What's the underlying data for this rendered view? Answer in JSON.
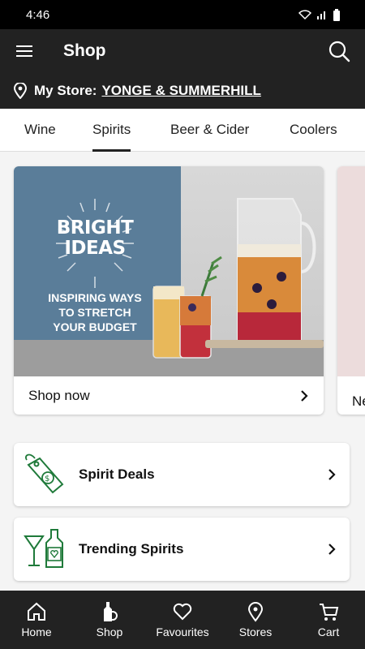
{
  "status": {
    "time": "4:46"
  },
  "header": {
    "title": "Shop"
  },
  "store": {
    "prefix": "My Store:",
    "name": "YONGE & SUMMERHILL"
  },
  "tabs": [
    {
      "label": "Wine"
    },
    {
      "label": "Spirits",
      "active": true
    },
    {
      "label": "Beer & Cider"
    },
    {
      "label": "Coolers"
    }
  ],
  "promo": {
    "heading_line1": "BRIGHT",
    "heading_line2": "IDEAS",
    "sub_line1": "INSPIRING WAYS",
    "sub_line2": "TO STRETCH",
    "sub_line3": "YOUR BUDGET",
    "cta": "Shop now"
  },
  "peek": {
    "label": "Ne"
  },
  "list": [
    {
      "label": "Spirit Deals",
      "icon": "price-tag-icon"
    },
    {
      "label": "Trending Spirits",
      "icon": "cocktail-bottle-icon"
    }
  ],
  "nav": [
    {
      "label": "Home",
      "icon": "home-icon"
    },
    {
      "label": "Shop",
      "icon": "bottle-icon"
    },
    {
      "label": "Favourites",
      "icon": "heart-icon"
    },
    {
      "label": "Stores",
      "icon": "location-pin-icon"
    },
    {
      "label": "Cart",
      "icon": "cart-icon"
    }
  ],
  "colors": {
    "bar": "#222222",
    "accent_green": "#1f7a3a",
    "promo_blue": "#5a7d99"
  }
}
